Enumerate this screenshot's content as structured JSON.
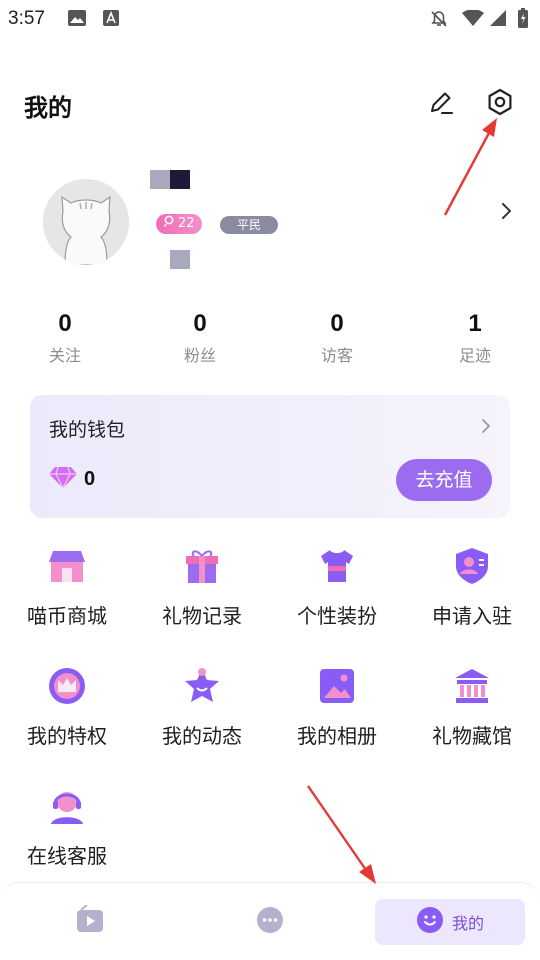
{
  "status_bar": {
    "time": "3:57",
    "icons": [
      "image-icon",
      "a-box-icon",
      "notifications-off-icon",
      "wifi-icon",
      "signal-icon",
      "battery-icon"
    ]
  },
  "header": {
    "title": "我的",
    "edit_icon": "pencil-icon",
    "settings_icon": "settings-hexagon-icon"
  },
  "profile": {
    "avatar_icon": "cat-avatar-icon",
    "level": "22",
    "rank": "平民"
  },
  "stats": [
    {
      "value": "0",
      "label": "关注"
    },
    {
      "value": "0",
      "label": "粉丝"
    },
    {
      "value": "0",
      "label": "访客"
    },
    {
      "value": "1",
      "label": "足迹"
    }
  ],
  "wallet": {
    "title": "我的钱包",
    "balance": "0",
    "currency_icon": "diamond-icon",
    "recharge_label": "去充值"
  },
  "grid": [
    {
      "label": "喵币商城",
      "icon": "shop-icon"
    },
    {
      "label": "礼物记录",
      "icon": "gift-icon"
    },
    {
      "label": "个性装扮",
      "icon": "tshirt-icon"
    },
    {
      "label": "申请入驻",
      "icon": "shield-user-icon"
    },
    {
      "label": "我的特权",
      "icon": "crown-icon"
    },
    {
      "label": "我的动态",
      "icon": "star-icon"
    },
    {
      "label": "我的相册",
      "icon": "album-icon"
    },
    {
      "label": "礼物藏馆",
      "icon": "museum-icon"
    },
    {
      "label": "在线客服",
      "icon": "headset-icon"
    }
  ],
  "bottom_nav": [
    {
      "label": "",
      "icon": "play-icon",
      "active": false
    },
    {
      "label": "",
      "icon": "chat-icon",
      "active": false
    },
    {
      "label": "我的",
      "icon": "smile-icon",
      "active": true
    }
  ],
  "colors": {
    "accent": "#9b6cf0",
    "icon_purple": "#8a5cf6",
    "icon_pink": "#f06db4",
    "arrow": "#e53935"
  }
}
